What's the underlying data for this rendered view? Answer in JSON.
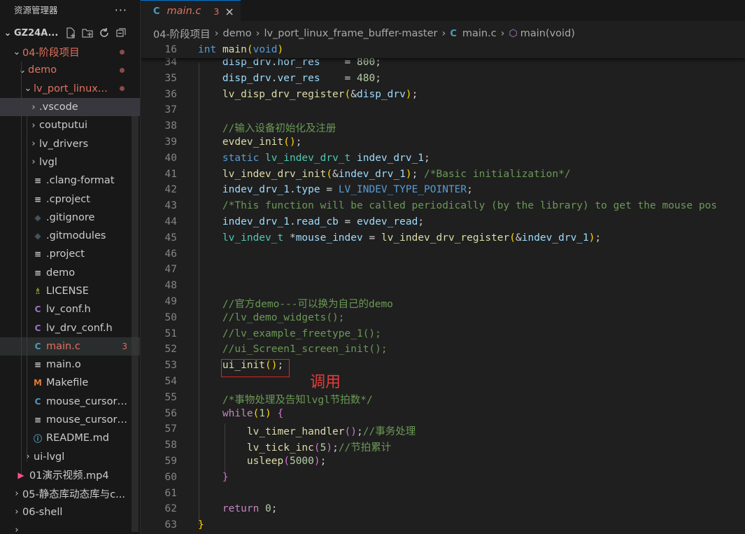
{
  "explorer": {
    "title": "资源管理器",
    "more": "···",
    "root": "GZ24A...",
    "items": [
      {
        "label": "04-阶段项目",
        "depth": 1,
        "chevron": "⌄",
        "icon": "",
        "mod": true,
        "dot": true
      },
      {
        "label": "demo",
        "depth": 2,
        "chevron": "⌄",
        "icon": "",
        "mod": true,
        "dot": true
      },
      {
        "label": "lv_port_linux...",
        "depth": 3,
        "chevron": "⌄",
        "icon": "",
        "mod": true,
        "dot": true
      },
      {
        "label": ".vscode",
        "depth": 4,
        "chevron": "›",
        "icon": "",
        "sel": true
      },
      {
        "label": "coutputui",
        "depth": 4,
        "chevron": "›",
        "icon": ""
      },
      {
        "label": "lv_drivers",
        "depth": 4,
        "chevron": "›",
        "icon": ""
      },
      {
        "label": "lvgl",
        "depth": 4,
        "chevron": "›",
        "icon": ""
      },
      {
        "label": ".clang-format",
        "depth": 4,
        "icon": "≡",
        "iconColor": "#cccccc"
      },
      {
        "label": ".cproject",
        "depth": 4,
        "icon": "≡",
        "iconColor": "#cccccc"
      },
      {
        "label": ".gitignore",
        "depth": 4,
        "icon": "◆",
        "iconColor": "#41535b"
      },
      {
        "label": ".gitmodules",
        "depth": 4,
        "icon": "◆",
        "iconColor": "#41535b"
      },
      {
        "label": ".project",
        "depth": 4,
        "icon": "≡",
        "iconColor": "#cccccc"
      },
      {
        "label": "demo",
        "depth": 4,
        "icon": "≡",
        "iconColor": "#cccccc"
      },
      {
        "label": "LICENSE",
        "depth": 4,
        "icon": "♗",
        "iconColor": "#cbcb41"
      },
      {
        "label": "lv_conf.h",
        "depth": 4,
        "icon": "C",
        "iconColor": "#a074c4"
      },
      {
        "label": "lv_drv_conf.h",
        "depth": 4,
        "icon": "C",
        "iconColor": "#a074c4"
      },
      {
        "label": "main.c",
        "depth": 4,
        "icon": "C",
        "iconColor": "#519aba",
        "mod": true,
        "count": "3",
        "hover": true
      },
      {
        "label": "main.o",
        "depth": 4,
        "icon": "≡",
        "iconColor": "#cccccc"
      },
      {
        "label": "Makefile",
        "depth": 4,
        "icon": "M",
        "iconColor": "#e37933"
      },
      {
        "label": "mouse_cursor_ic...",
        "depth": 4,
        "icon": "C",
        "iconColor": "#519aba"
      },
      {
        "label": "mouse_cursor_ic...",
        "depth": 4,
        "icon": "≡",
        "iconColor": "#cccccc"
      },
      {
        "label": "README.md",
        "depth": 4,
        "icon": "ⓘ",
        "iconColor": "#519aba"
      },
      {
        "label": "ui-lvgl",
        "depth": 3,
        "chevron": "›",
        "icon": ""
      },
      {
        "label": "01演示视频.mp4",
        "depth": 1,
        "icon": "▶",
        "iconColor": "#f55385"
      },
      {
        "label": "05-静态库动态库与c...",
        "depth": 0,
        "chevron": "›",
        "icon": ""
      },
      {
        "label": "06-shell",
        "depth": 0,
        "chevron": "›",
        "icon": ""
      },
      {
        "label": "",
        "depth": 0,
        "chevron": "›",
        "icon": ""
      }
    ]
  },
  "tab": {
    "icon": "C",
    "name": "main.c",
    "count": "3",
    "close": "×"
  },
  "breadcrumb": {
    "parts": [
      "04-阶段项目",
      "demo",
      "lv_port_linux_frame_buffer-master"
    ],
    "file_icon": "C",
    "file": "main.c",
    "symbol_icon": "⬡",
    "symbol": "main(void)"
  },
  "sticky": {
    "line": "16"
  },
  "code": [
    {
      "n": "34",
      "html": "    <span class='vr'>disp_drv</span>.<span class='vr'>hor_res</span>    = <span class='nm'>800</span>;"
    },
    {
      "n": "35",
      "html": "    <span class='vr'>disp_drv</span>.<span class='vr'>ver_res</span>    = <span class='nm'>480</span>;"
    },
    {
      "n": "36",
      "html": "    <span class='fn'>lv_disp_drv_register</span><span class='br'>(</span>&amp;<span class='vr'>disp_drv</span><span class='br'>)</span>;"
    },
    {
      "n": "37",
      "html": ""
    },
    {
      "n": "38",
      "html": "    <span class='cm'>//输入设备初始化及注册</span>"
    },
    {
      "n": "39",
      "html": "    <span class='fn'>evdev_init</span><span class='br'>()</span>;"
    },
    {
      "n": "40",
      "html": "    <span class='kw'>static</span> <span class='ty'>lv_indev_drv_t</span> <span class='vr'>indev_drv_1</span>;"
    },
    {
      "n": "41",
      "html": "    <span class='fn'>lv_indev_drv_init</span><span class='br'>(</span>&amp;<span class='vr'>indev_drv_1</span><span class='br'>)</span>; <span class='cm'>/*Basic initialization*/</span>"
    },
    {
      "n": "42",
      "html": "    <span class='vr'>indev_drv_1</span>.<span class='vr'>type</span> = <span class='kw'>LV_INDEV_TYPE_POINTER</span>;"
    },
    {
      "n": "43",
      "html": "    <span class='cm'>/*This function will be called periodically (by the library) to get the mouse pos</span>"
    },
    {
      "n": "44",
      "html": "    <span class='vr'>indev_drv_1</span>.<span class='vr'>read_cb</span> = <span class='vr'>evdev_read</span>;"
    },
    {
      "n": "45",
      "html": "    <span class='ty'>lv_indev_t</span> *<span class='vr'>mouse_indev</span> = <span class='fn'>lv_indev_drv_register</span><span class='br'>(</span>&amp;<span class='vr'>indev_drv_1</span><span class='br'>)</span>;"
    },
    {
      "n": "46",
      "html": ""
    },
    {
      "n": "47",
      "html": ""
    },
    {
      "n": "48",
      "html": ""
    },
    {
      "n": "49",
      "html": "    <span class='cm'>//官方demo---可以换为自己的demo</span>"
    },
    {
      "n": "50",
      "html": "    <span class='cm'>//lv_demo_widgets();</span>"
    },
    {
      "n": "51",
      "html": "    <span class='cm'>//lv_example_freetype_1();</span>"
    },
    {
      "n": "52",
      "html": "    <span class='cm'>//ui_Screen1_screen_init();</span>"
    },
    {
      "n": "53",
      "html": "    <span class='fn'>ui_init</span><span class='br'>()</span>;"
    },
    {
      "n": "54",
      "html": ""
    },
    {
      "n": "55",
      "html": "    <span class='cm'>/*事物处理及告知lvgl节拍数*/</span>"
    },
    {
      "n": "56",
      "html": "    <span class='ct'>while</span><span class='br'>(</span><span class='nm'>1</span><span class='br'>)</span> <span class='pr'>{</span>"
    },
    {
      "n": "57",
      "html": "        <span class='fn'>lv_timer_handler</span><span class='pr'>()</span>;<span class='cm'>//事务处理</span>"
    },
    {
      "n": "58",
      "html": "        <span class='fn'>lv_tick_inc</span><span class='pr'>(</span><span class='nm'>5</span><span class='pr'>)</span>;<span class='cm'>//节拍累计</span>"
    },
    {
      "n": "59",
      "html": "        <span class='fn'>usleep</span><span class='pr'>(</span><span class='nm'>5000</span><span class='pr'>)</span>;"
    },
    {
      "n": "60",
      "html": "    <span class='pr'>}</span>"
    },
    {
      "n": "61",
      "html": ""
    },
    {
      "n": "62",
      "html": "    <span class='ct'>return</span> <span class='nm'>0</span>;"
    },
    {
      "n": "63",
      "html": "<span class='br'>}</span>"
    }
  ],
  "annotation": {
    "label": "调用"
  }
}
